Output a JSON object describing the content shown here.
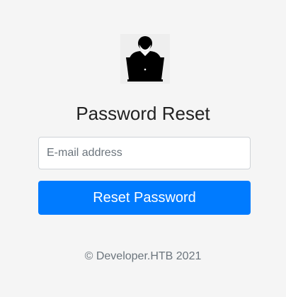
{
  "logo": {
    "icon": "developer-laptop-icon"
  },
  "form": {
    "title": "Password Reset",
    "email_placeholder": "E-mail address",
    "email_value": "",
    "submit_label": "Reset Password"
  },
  "footer": {
    "text": "© Developer.HTB 2021"
  },
  "colors": {
    "background": "#f5f5f5",
    "primary": "#007bff",
    "muted_text": "#6c757d"
  }
}
